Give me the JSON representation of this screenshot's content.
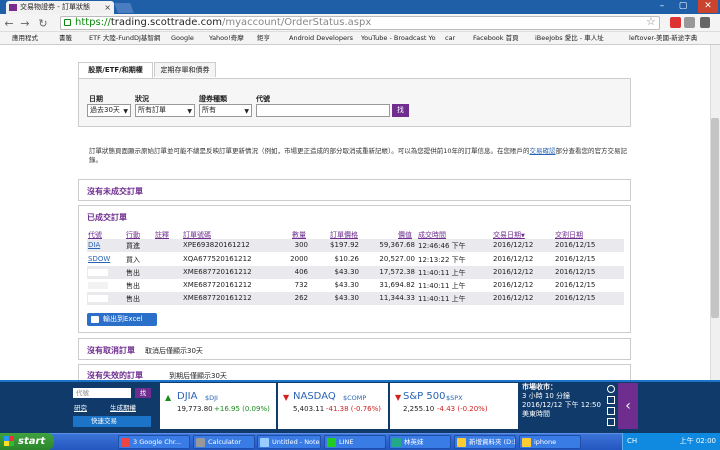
{
  "browser": {
    "tab_title": "交易物證券 - 訂單狀態",
    "tab_close": "×",
    "url_scheme": "https://",
    "url_host": "trading.scottrade.com",
    "url_path": "/myaccount/OrderStatus.aspx",
    "win_min": "–",
    "win_max": "▢",
    "win_close": "✕",
    "back": "←",
    "forward": "→",
    "reload": "↻",
    "star": "☆"
  },
  "bookmarks": [
    {
      "label": "應用程式",
      "color": "#4a7cc0"
    },
    {
      "label": "書籤",
      "color": "#e0b030"
    },
    {
      "label": "ETF 大陸-FundDJ基智網",
      "color": "#3a6ec0"
    },
    {
      "label": "Google",
      "color": "#e44"
    },
    {
      "label": "Yahoo!奇摩",
      "color": "#7a2b8f"
    },
    {
      "label": "鉅亨",
      "color": "#333"
    },
    {
      "label": "Android Developers",
      "color": "#8bc34a"
    },
    {
      "label": "YouTube - Broadcast Yo",
      "color": "#e22"
    },
    {
      "label": "car",
      "color": "#e0b030"
    },
    {
      "label": "Facebook 首頁",
      "color": "#3b5998"
    },
    {
      "label": "iBeeJobs 愛比 - 車人址",
      "color": "#f39c12"
    },
    {
      "label": "leftover-美國-新途字典",
      "color": "#c0392b"
    }
  ],
  "tabs": {
    "stocks": "股票/ETF/和期權",
    "periodic": "定期存單和債券"
  },
  "filters": {
    "date_label": "日期",
    "date_value": "過去30天",
    "status_label": "狀況",
    "status_value": "所有訂單",
    "type_label": "證券種類",
    "type_value": "所有",
    "code_label": "代號",
    "code_value": "",
    "search": "找"
  },
  "info": {
    "text": "訂單狀態頁面顯示原始訂單並可能不總是反映訂單更新情況（例如，市場更正造成的部分取消或重新記帳）。可以為您提供前10年的訂單信息。在您賬戶的",
    "link": "交易確認",
    "text2": "部分查看您的官方交易記錄。"
  },
  "open_orders": {
    "title": "沒有未成交訂單"
  },
  "filled": {
    "title": "已成交訂單",
    "headers": [
      "代號",
      "行動",
      "註釋",
      "訂單號碼",
      "數量",
      "訂單價格",
      "價值",
      "成交時間",
      "交易日期",
      "交割日期"
    ],
    "sort_arrow": "▼",
    "rows": [
      {
        "symbol": "DIA",
        "action": "買進",
        "note": "",
        "order": "XPE693820161212",
        "qty": "300",
        "price": "$197.92",
        "value": "59,367.68",
        "time": "12:46:46 下午",
        "trade": "2016/12/12",
        "settle": "2016/12/15"
      },
      {
        "symbol": "SDOW",
        "action": "買入",
        "note": "",
        "order": "XQA677520161212",
        "qty": "2000",
        "price": "$10.26",
        "value": "20,527.00",
        "time": "12:13:22 下午",
        "trade": "2016/12/12",
        "settle": "2016/12/15"
      },
      {
        "symbol": "",
        "action": "售出",
        "note": "",
        "order": "XME687720161212",
        "qty": "406",
        "price": "$43.30",
        "value": "17,572.38",
        "time": "11:40:11 上午",
        "trade": "2016/12/12",
        "settle": "2016/12/15"
      },
      {
        "symbol": "",
        "action": "售出",
        "note": "",
        "order": "XME687720161212",
        "qty": "732",
        "price": "$43.30",
        "value": "31,694.82",
        "time": "11:40:11 上午",
        "trade": "2016/12/12",
        "settle": "2016/12/15"
      },
      {
        "symbol": "",
        "action": "售出",
        "note": "",
        "order": "XME687720161212",
        "qty": "262",
        "price": "$43.30",
        "value": "11,344.33",
        "time": "11:40:11 上午",
        "trade": "2016/12/12",
        "settle": "2016/12/15"
      }
    ],
    "export": "輸出到Excel"
  },
  "cancelled": {
    "title": "沒有取消訂單",
    "note": "取消后僅顯示30天"
  },
  "expired": {
    "title": "沒有失效的訂單",
    "note": "到期后僅顯示30天"
  },
  "ticker": {
    "code_placeholder": "代號",
    "go": "找",
    "research": "研究",
    "alerts": "生成期權",
    "quick_trade": "快速交易",
    "indices": [
      {
        "name": "DJIA",
        "sub": "$DJI",
        "value": "19,773.80",
        "change": "+16.95 (0.09%)",
        "dir": "▲",
        "up": true
      },
      {
        "name": "NASDAQ",
        "sub": "$COMP",
        "value": "5,403.11",
        "change": "-41.38 (-0.76%)",
        "dir": "▼",
        "up": false
      },
      {
        "name": "S&P 500",
        "sub": "$SPX",
        "value": "2,255.10",
        "change": "-4.43 (-0.20%)",
        "dir": "▼",
        "up": false
      }
    ],
    "market_label": "市場收市：",
    "market_time": "3 小時 10 分鐘",
    "datetime": "2016/12/12 下午 12:50",
    "tz": "美東時間",
    "collapse": "‹"
  },
  "taskbar": {
    "start": "start",
    "tasks": [
      {
        "label": "3 Google Chr...",
        "color": "#e44"
      },
      {
        "label": "Calculator",
        "color": "#999"
      },
      {
        "label": "Untitled - Note...",
        "color": "#9cf"
      },
      {
        "label": "LINE",
        "color": "#2c2"
      },
      {
        "label": "林英妹",
        "color": "#2a8"
      },
      {
        "label": "新增資料夾 (D:)",
        "color": "#fc3"
      },
      {
        "label": "iphone",
        "color": "#fc3"
      }
    ],
    "tray_text": "CH",
    "tray_time": "上午 02:00"
  },
  "colors": {
    "accent": "#6e2d8f",
    "link": "#2a64b4",
    "up": "#1a8a1a",
    "down": "#d02020"
  }
}
